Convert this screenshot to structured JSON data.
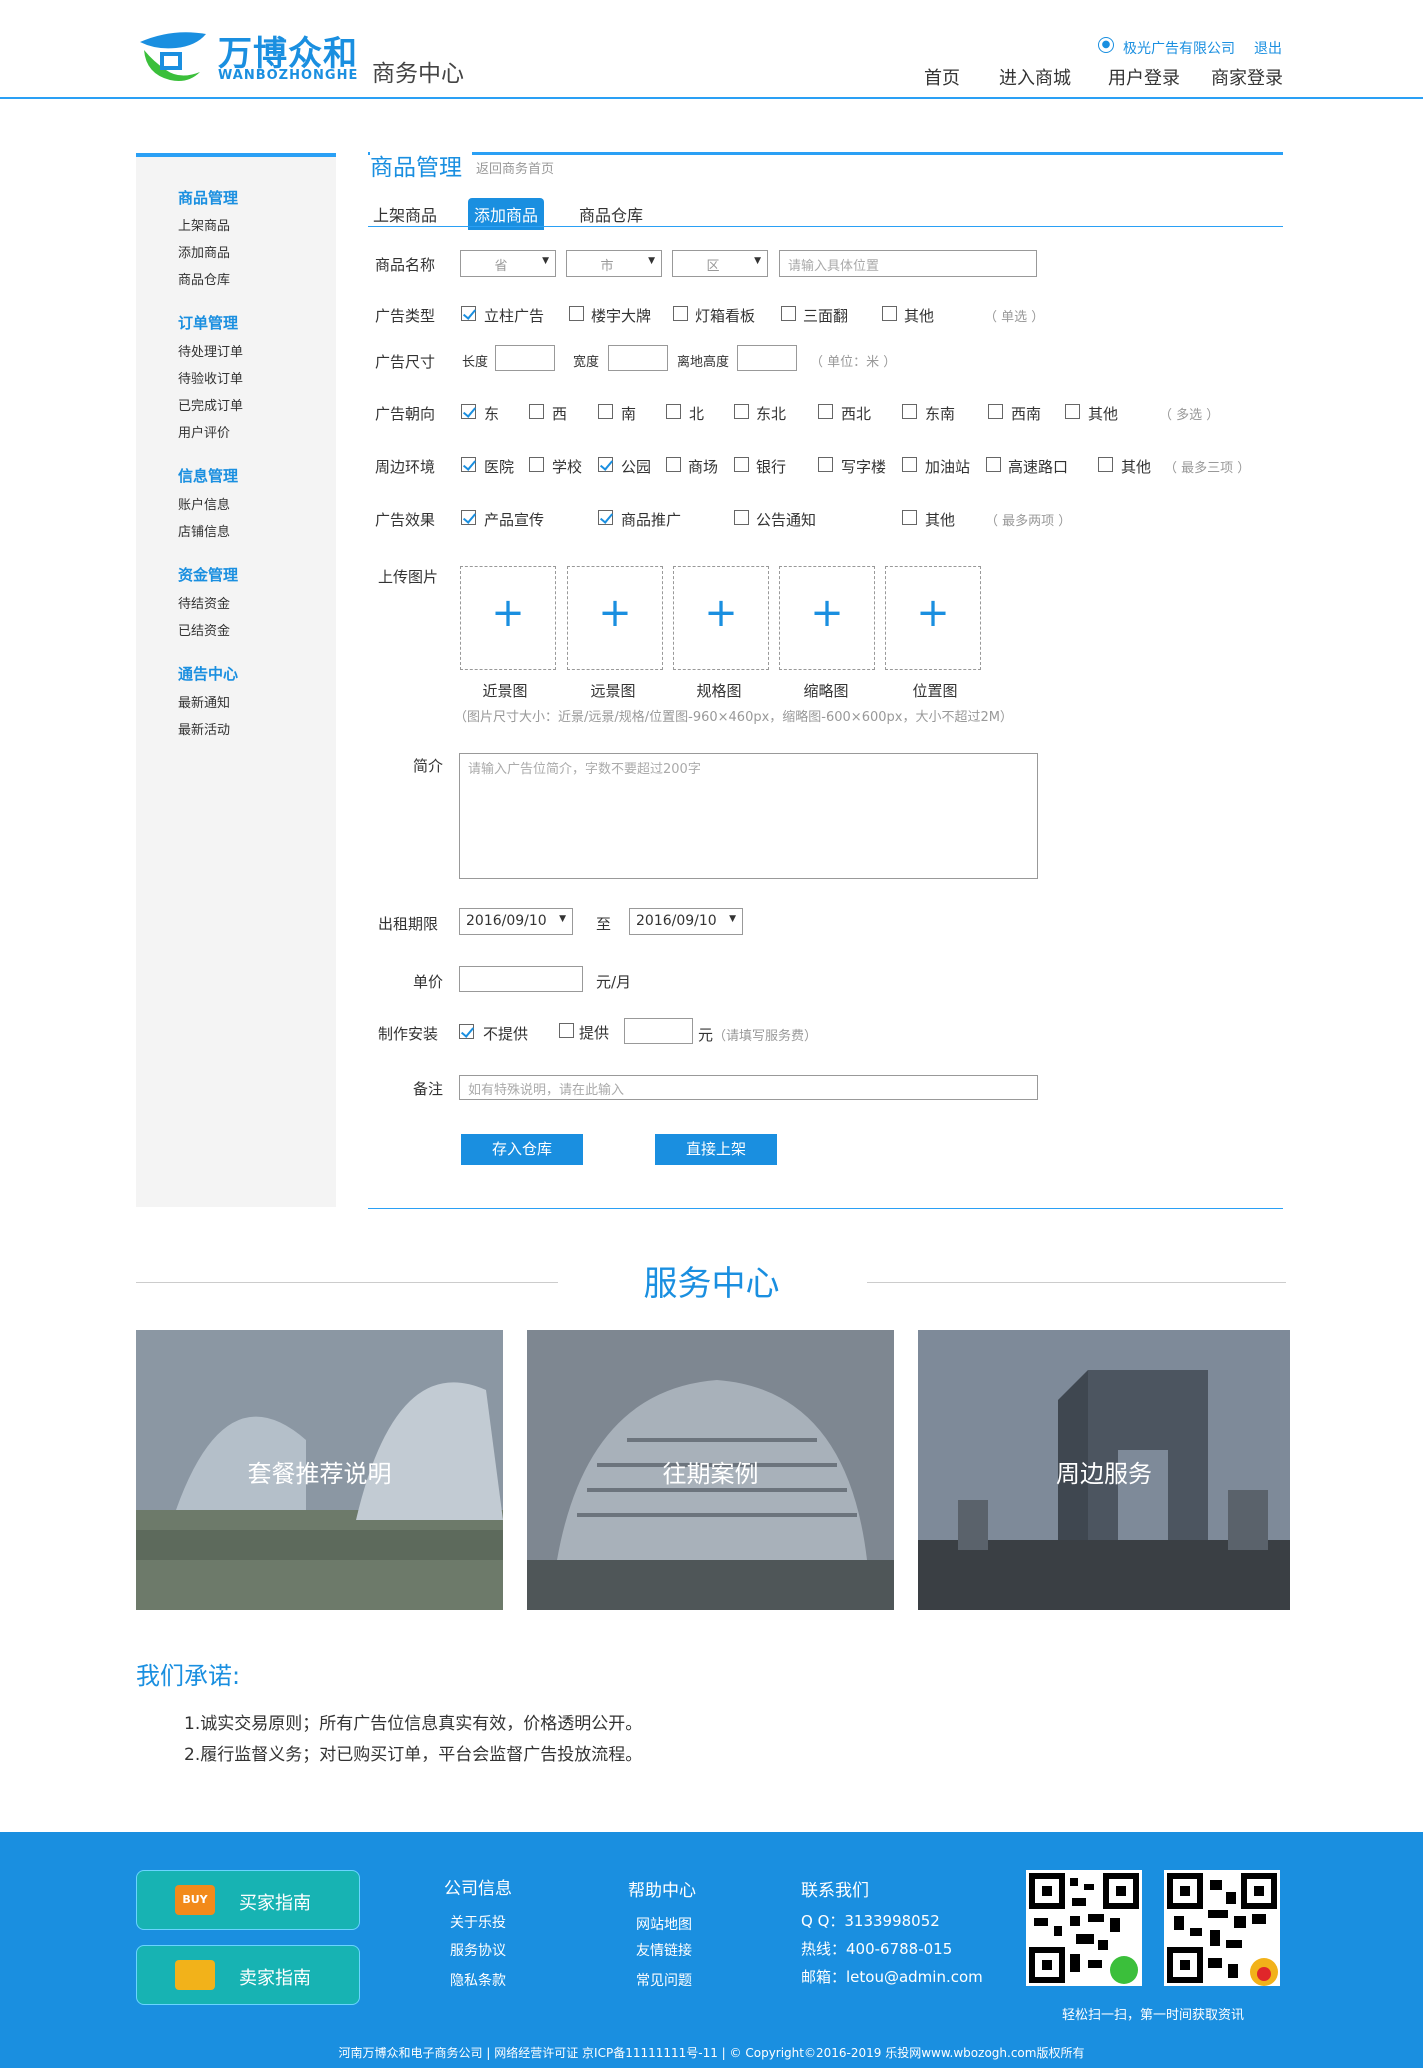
{
  "header": {
    "logo_cn": "万博众和",
    "logo_en": "WANBOZHONGHE",
    "logo_sub": "商务中心",
    "company": "极光广告有限公司",
    "logout": "退出",
    "nav": [
      "首页",
      "进入商城",
      "用户登录",
      "商家登录"
    ]
  },
  "sidebar": {
    "groups": [
      {
        "title": "商品管理",
        "items": [
          "上架商品",
          "添加商品",
          "商品仓库"
        ]
      },
      {
        "title": "订单管理",
        "items": [
          "待处理订单",
          "待验收订单",
          "已完成订单",
          "用户评价"
        ]
      },
      {
        "title": "信息管理",
        "items": [
          "账户信息",
          "店铺信息"
        ]
      },
      {
        "title": "资金管理",
        "items": [
          "待结资金",
          "已结资金"
        ]
      },
      {
        "title": "通告中心",
        "items": [
          "最新通知",
          "最新活动"
        ]
      }
    ]
  },
  "main": {
    "title": "商品管理",
    "back_link": "返回商务首页",
    "tabs": [
      "上架商品",
      "添加商品",
      "商品仓库"
    ],
    "active_tab": "添加商品",
    "name_label": "商品名称",
    "province": "省",
    "city": "市",
    "district": "区",
    "address_placeholder": "请输入具体位置",
    "type_label": "广告类型",
    "types": [
      "立柱广告",
      "楼宇大牌",
      "灯箱看板",
      "三面翻",
      "其他"
    ],
    "type_note": "（ 单选 ）",
    "size_label": "广告尺寸",
    "size_fields": [
      "长度",
      "宽度",
      "离地高度"
    ],
    "size_note": "（ 单位：米 ）",
    "orient_label": "广告朝向",
    "orients": [
      "东",
      "西",
      "南",
      "北",
      "东北",
      "西北",
      "东南",
      "西南",
      "其他"
    ],
    "orient_note": "（ 多选 ）",
    "env_label": "周边环境",
    "envs": [
      "医院",
      "学校",
      "公园",
      "商场",
      "银行",
      "写字楼",
      "加油站",
      "高速路口",
      "其他"
    ],
    "env_note": "（ 最多三项 ）",
    "effect_label": "广告效果",
    "effects": [
      "产品宣传",
      "商品推广",
      "公告通知",
      "其他"
    ],
    "effect_note": "（ 最多两项 ）",
    "upload_label": "上传图片",
    "uploads": [
      "近景图",
      "远景图",
      "规格图",
      "缩略图",
      "位置图"
    ],
    "upload_plus": "+",
    "upload_note": "（图片尺寸大小：近景/远景/规格/位置图-960×460px，缩略图-600×600px，大小不超过2M）",
    "intro_label": "简介",
    "intro_placeholder": "请输入广告位简介，字数不要超过200字",
    "period_label": "出租期限",
    "date_from": "2016/09/10",
    "date_to": "2016/09/10",
    "period_to": "至",
    "price_label": "单价",
    "price_unit": "元/月",
    "install_label": "制作安装",
    "install_no": "不提供",
    "install_yes": "提供",
    "install_unit": "元",
    "install_note": "（请填写服务费）",
    "remark_label": "备注",
    "remark_placeholder": "如有特殊说明，请在此输入",
    "btn_save": "存入仓库",
    "btn_publish": "直接上架"
  },
  "service": {
    "title": "服务中心",
    "cards": [
      "套餐推荐说明",
      "往期案例",
      "周边服务"
    ]
  },
  "promise": {
    "title": "我们承诺:",
    "items": [
      "1.诚实交易原则；所有广告位信息真实有效，价格透明公开。",
      "2.履行监督义务；对已购买订单，平台会监督广告投放流程。"
    ]
  },
  "footer": {
    "buyer_guide": "买家指南",
    "buy_badge": "BUY",
    "seller_guide": "卖家指南",
    "company_title": "公司信息",
    "company_items": [
      "关于乐投",
      "服务协议",
      "隐私条款"
    ],
    "help_title": "帮助中心",
    "help_items": [
      "网站地图",
      "友情链接",
      "常见问题"
    ],
    "contact_title": "联系我们",
    "contact_items": [
      "Q Q：3133998052",
      "热线：400-6788-015",
      "邮箱：letou@admin.com"
    ],
    "qr_caption": "轻松扫一扫，第一时间获取资讯",
    "copyright": "河南万博众和电子商务公司 | 网络经营许可证 京ICP备11111111号-11 | © Copyright©2016-2019  乐投网www.wbozogh.com版权所有"
  },
  "colors": {
    "accent": "#1a8fe0",
    "footer": "#1a8fe0",
    "sidebar_bg": "#f4f4f4"
  }
}
